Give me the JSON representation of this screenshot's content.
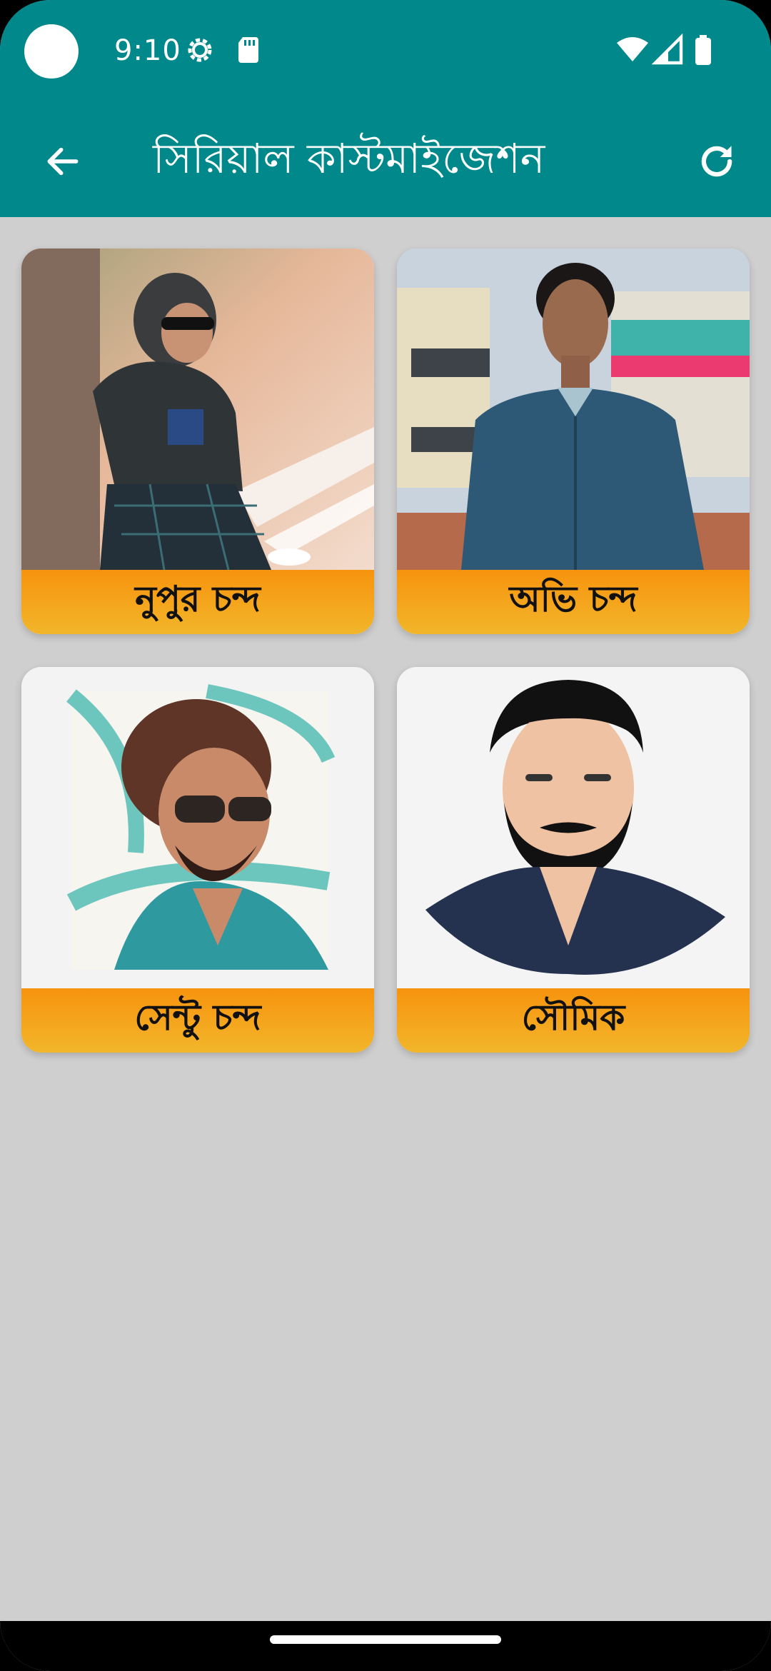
{
  "status_bar": {
    "time": "9:10",
    "icons": [
      "settings-gear-icon",
      "sd-card-icon",
      "wifi-icon",
      "signal-icon",
      "battery-icon"
    ]
  },
  "app_bar": {
    "title": "সিরিয়াল কাস্টমাইজেশন",
    "back_icon": "arrow-left-icon",
    "refresh_icon": "refresh-icon"
  },
  "cards": [
    {
      "name": "নুপুর চন্দ",
      "photo": "person-photo-hoodie-sunglasses"
    },
    {
      "name": "অভি চন্দ",
      "photo": "person-photo-blue-shirt"
    },
    {
      "name": "সেন্টু চন্দ",
      "photo": "cartoon-portrait-sunglasses"
    },
    {
      "name": "সৌমিক",
      "photo": "vector-portrait-beard"
    }
  ],
  "colors": {
    "primary": "#00888a",
    "background": "#cfcfcf",
    "label_top": "#f7930e",
    "label_bottom": "#f2b62a"
  }
}
